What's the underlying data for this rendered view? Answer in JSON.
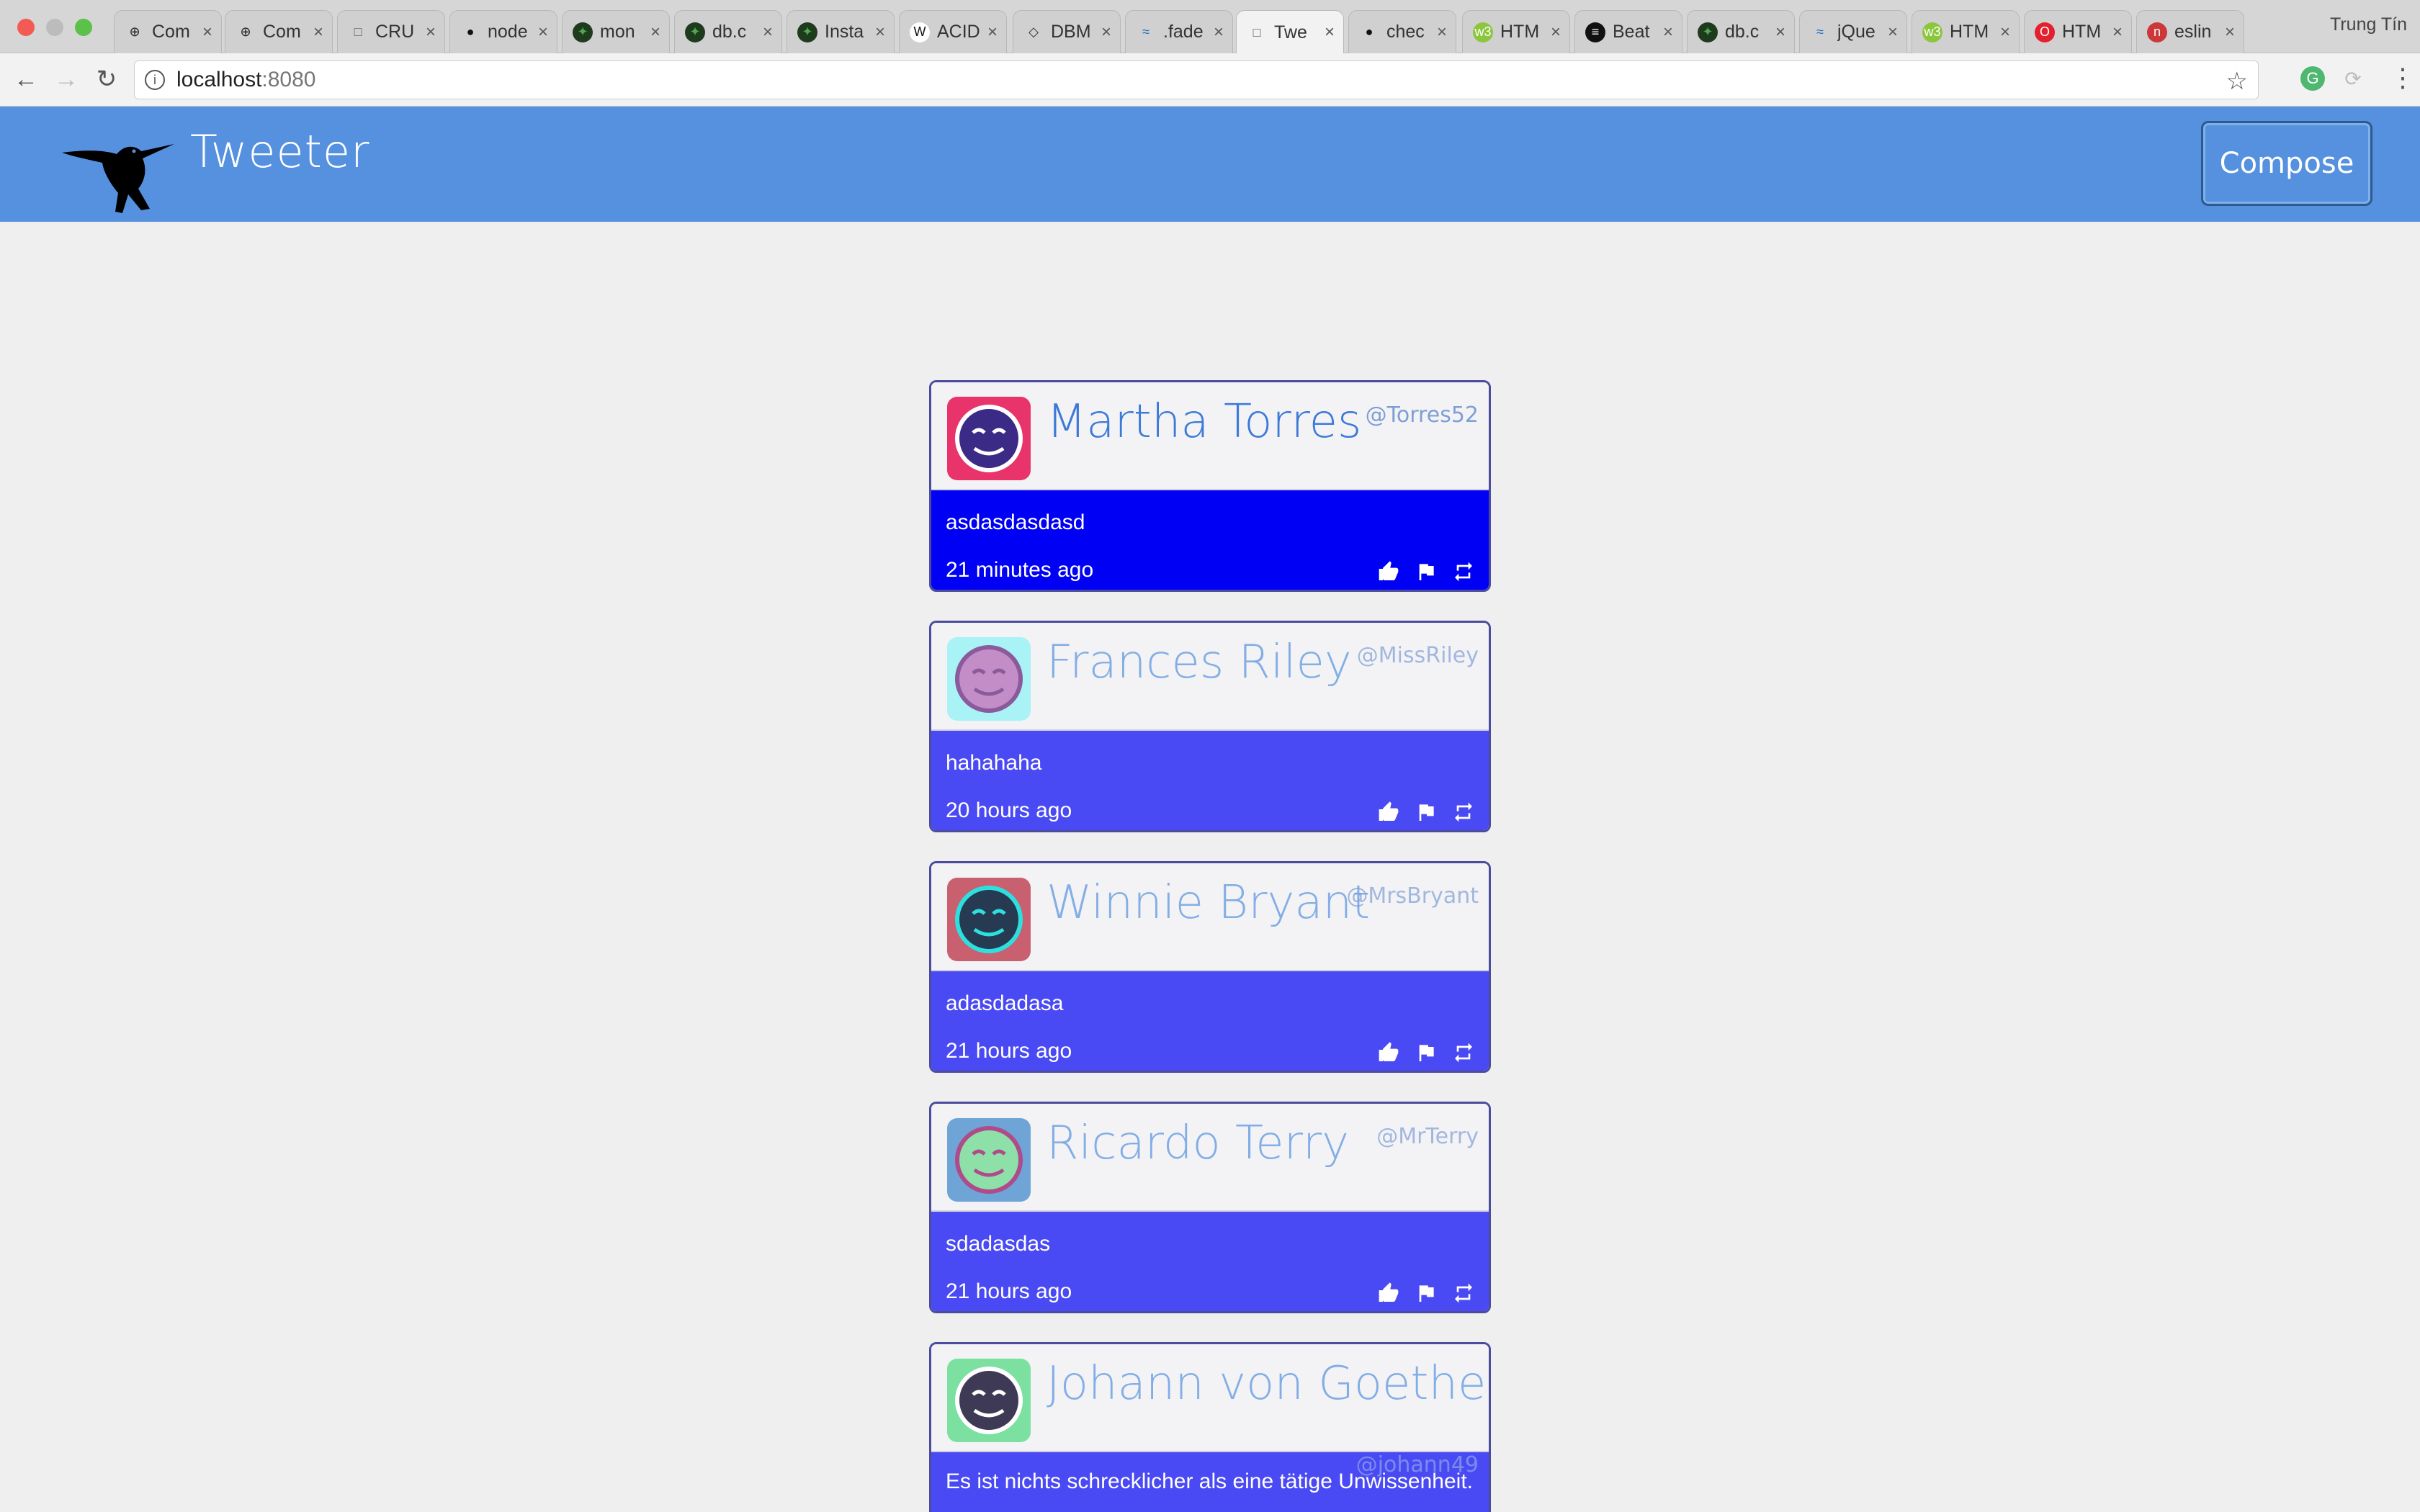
{
  "browser": {
    "tabs": [
      {
        "label": "Com",
        "icon": "plus-circle-icon"
      },
      {
        "label": "Com",
        "icon": "plus-circle-icon"
      },
      {
        "label": "CRU",
        "icon": "document-icon"
      },
      {
        "label": "node",
        "icon": "github-icon"
      },
      {
        "label": "mon",
        "icon": "mongodb-leaf-icon"
      },
      {
        "label": "db.c",
        "icon": "mongodb-leaf-icon"
      },
      {
        "label": "Insta",
        "icon": "mongodb-leaf-icon"
      },
      {
        "label": "ACID",
        "icon": "wikipedia-icon"
      },
      {
        "label": "DBM",
        "icon": "diamond-icon"
      },
      {
        "label": ".fade",
        "icon": "jquery-icon"
      },
      {
        "label": "Twe",
        "icon": "document-icon",
        "active": true
      },
      {
        "label": "chec",
        "icon": "github-icon"
      },
      {
        "label": "HTM",
        "icon": "w3-icon"
      },
      {
        "label": "Beat",
        "icon": "spotify-icon"
      },
      {
        "label": "db.c",
        "icon": "mongodb-leaf-icon"
      },
      {
        "label": "jQue",
        "icon": "jquery-icon"
      },
      {
        "label": "HTM",
        "icon": "w3-icon"
      },
      {
        "label": "HTM",
        "icon": "opera-icon"
      },
      {
        "label": "eslin",
        "icon": "npm-icon"
      }
    ],
    "profile_name": "Trung Tín",
    "url_host": "localhost",
    "url_port": ":8080"
  },
  "app": {
    "title": "Tweeter",
    "compose_label": "Compose"
  },
  "tweets": [
    {
      "name": "Martha Torres",
      "handle": "@Torres52",
      "text": "asdasdasdasd",
      "time": "21 minutes ago",
      "avatar_bg": "#e8336b",
      "avatar_face": "#3b2a86",
      "avatar_line": "#ffffff"
    },
    {
      "name": "Frances Riley",
      "handle": "@MissRiley",
      "text": "hahahaha",
      "time": "20 hours ago",
      "avatar_bg": "#a9f2f5",
      "avatar_face": "#c38ec8",
      "avatar_line": "#8a5a9b"
    },
    {
      "name": "Winnie Bryant",
      "handle": "@MrsBryant",
      "text": "adasdadasa",
      "time": "21 hours ago",
      "avatar_bg": "#c86070",
      "avatar_face": "#263a52",
      "avatar_line": "#2de0e0"
    },
    {
      "name": "Ricardo Terry",
      "handle": "@MrTerry",
      "text": "sdadasdas",
      "time": "21 hours ago",
      "avatar_bg": "#6fa4d6",
      "avatar_face": "#8de0a8",
      "avatar_line": "#b04a8a"
    },
    {
      "name": "Johann von Goethe",
      "handle": "@johann49",
      "text": "Es ist nichts schrecklicher als eine tätige Unwissenheit.",
      "time": "",
      "avatar_bg": "#7ce0a0",
      "avatar_face": "#3e3a56",
      "avatar_line": "#ffffff"
    }
  ]
}
